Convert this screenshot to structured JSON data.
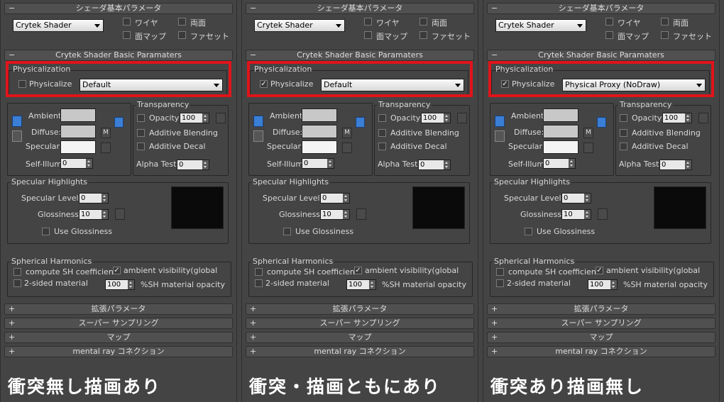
{
  "common": {
    "shader_rollout_title": "シェーダ基本パラメータ",
    "shader_type": "Crytek Shader",
    "wire_label": "ワイヤ",
    "two_sided_label": "両面",
    "face_map_label": "面マップ",
    "faceted_label": "ファセット",
    "crytek_rollout_title": "Crytek Shader Basic Paramaters",
    "physicalization_title": "Physicalization",
    "physicalize_label": "Physicalize",
    "ambient_label": "Ambient:",
    "diffuse_label": "Diffuse:",
    "specular_label": "Specular:",
    "self_illum_label": "Self-Illum:",
    "self_illum_value": "0",
    "transparency_title": "Transparency",
    "opacity_label": "Opacity:",
    "opacity_value": "100",
    "additive_blending_label": "Additive Blending",
    "additive_decal_label": "Additive Decal",
    "alpha_test_label": "Alpha Test:",
    "alpha_test_value": "0",
    "map_button_label": "M",
    "spec_title": "Specular Highlights",
    "spec_level_label": "Specular Level:",
    "spec_level_value": "0",
    "glossiness_label": "Glossiness:",
    "glossiness_value": "10",
    "use_glossiness_label": "Use Glossiness",
    "sh_title": "Spherical Harmonics",
    "compute_sh_label": "compute SH coefficients",
    "ambient_visibility_label": "ambient visibility(global",
    "two_sided_material_label": "2-sided material",
    "sh_opacity_value": "100",
    "sh_opacity_label": "%SH material opacity",
    "rollout_extended": "拡張パラメータ",
    "rollout_supersampling": "スーパー サンプリング",
    "rollout_maps": "マップ",
    "rollout_mentalray": "mental ray コネクション",
    "plus": "+",
    "minus": "−",
    "check": "✓"
  },
  "panels": [
    {
      "physicalize_checked": false,
      "preset": "Default",
      "caption": "衝突無し描画あり"
    },
    {
      "physicalize_checked": true,
      "preset": "Default",
      "caption": "衝突・描画ともにあり"
    },
    {
      "physicalize_checked": true,
      "preset": "Physical Proxy (NoDraw)",
      "caption": "衝突あり描画無し"
    }
  ],
  "colors": {
    "highlight_red": "#e0141a",
    "panel_bg": "#444444",
    "ambient_swatch": "#c8c8c8",
    "diffuse_swatch": "#c8c8c8",
    "specular_swatch": "#f4f4f4",
    "preview_black": "#0a0a0a"
  }
}
